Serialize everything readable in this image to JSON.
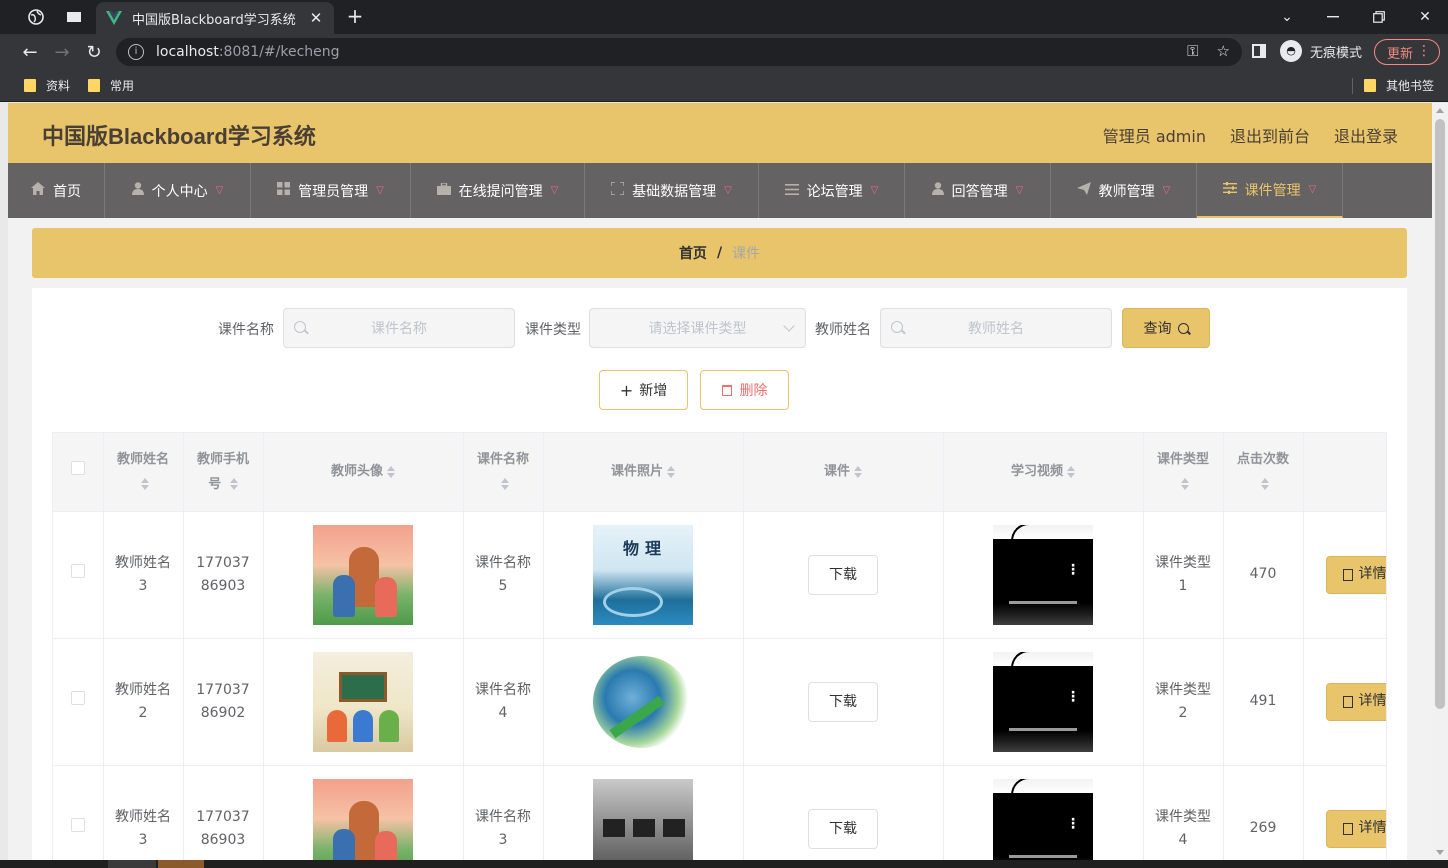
{
  "browser": {
    "tab_title": "中国版Blackboard学习系统",
    "tab_close": "✕",
    "new_tab": "+",
    "url_host": "localhost",
    "url_rest": ":8081/#/kecheng",
    "incognito_label": "无痕模式",
    "update_label": "更新",
    "bookmarks": [
      "资料",
      "常用"
    ],
    "other_bookmarks": "其他书签"
  },
  "header": {
    "title": "中国版Blackboard学习系统",
    "user_label": "管理员 admin",
    "to_front": "退出到前台",
    "logout": "退出登录"
  },
  "nav": {
    "items": [
      {
        "label": "首页",
        "icon": "home-icon"
      },
      {
        "label": "个人中心",
        "icon": "user-icon"
      },
      {
        "label": "管理员管理",
        "icon": "grid-icon"
      },
      {
        "label": "在线提问管理",
        "icon": "briefcase-icon"
      },
      {
        "label": "基础数据管理",
        "icon": "fullscreen-icon"
      },
      {
        "label": "论坛管理",
        "icon": "list-icon"
      },
      {
        "label": "回答管理",
        "icon": "user-icon"
      },
      {
        "label": "教师管理",
        "icon": "send-icon"
      },
      {
        "label": "课件管理",
        "icon": "sliders-icon"
      }
    ]
  },
  "breadcrumb": {
    "home": "首页",
    "sep": "/",
    "current": "课件"
  },
  "search": {
    "name_label": "课件名称",
    "name_placeholder": "课件名称",
    "type_label": "课件类型",
    "type_placeholder": "请选择课件类型",
    "teacher_label": "教师姓名",
    "teacher_placeholder": "教师姓名",
    "query_label": "查询"
  },
  "actions": {
    "add": "新增",
    "delete": "删除"
  },
  "table": {
    "headers": [
      "教师姓名",
      "教师手机号",
      "教师头像",
      "课件名称",
      "课件照片",
      "课件",
      "学习视频",
      "课件类型",
      "点击次数"
    ],
    "download_label": "下载",
    "detail_label": "详情",
    "rows": [
      {
        "teacher": "教师姓名3",
        "phone": "17703786903",
        "name": "课件名称5",
        "type": "课件类型1",
        "clicks": "470"
      },
      {
        "teacher": "教师姓名2",
        "phone": "17703786902",
        "name": "课件名称4",
        "type": "课件类型2",
        "clicks": "491"
      },
      {
        "teacher": "教师姓名3",
        "phone": "17703786903",
        "name": "课件名称3",
        "type": "课件类型4",
        "clicks": "269"
      }
    ]
  },
  "colors": {
    "accent": "#e8c46a",
    "nav_bg": "#646262",
    "danger": "#f56c6c"
  }
}
